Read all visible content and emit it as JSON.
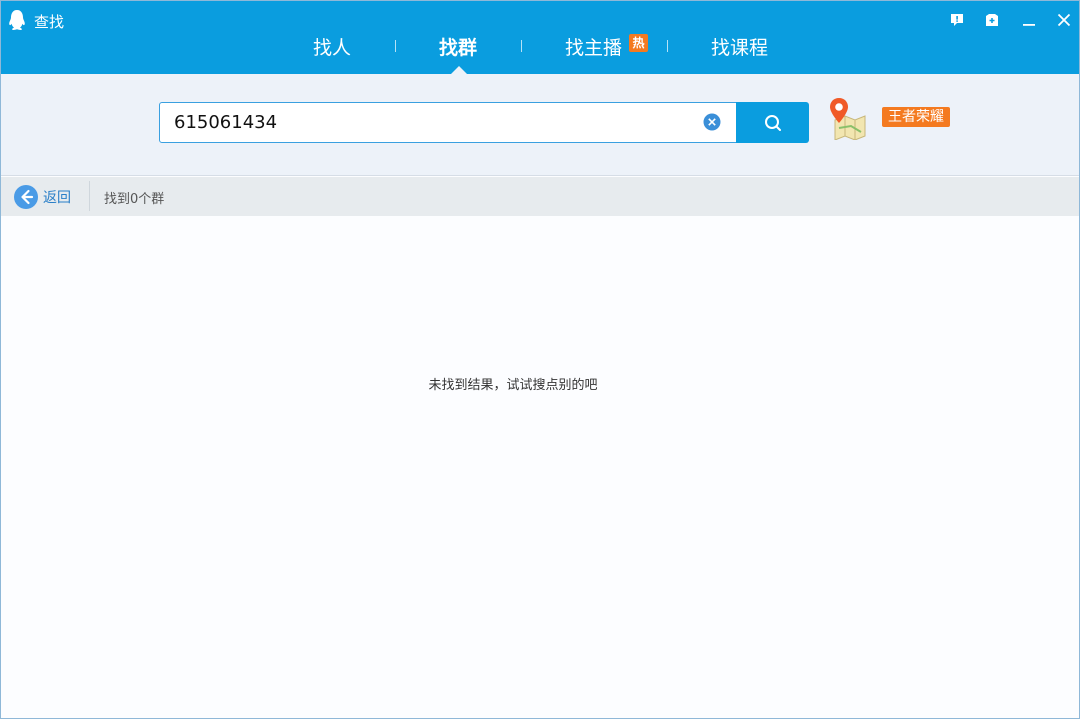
{
  "window": {
    "title": "查找",
    "buttons": [
      "feedback-icon",
      "skin-icon",
      "minimize-icon",
      "close-icon"
    ]
  },
  "tabs": [
    {
      "label": "找人",
      "active": false
    },
    {
      "label": "找群",
      "active": true
    },
    {
      "label": "找主播",
      "active": false,
      "badge": "热"
    },
    {
      "label": "找课程",
      "active": false
    }
  ],
  "search": {
    "value": "615061434",
    "location_tag": "王者荣耀"
  },
  "result_bar": {
    "back_label": "返回",
    "count_text": "找到0个群"
  },
  "content": {
    "empty_message": "未找到结果，试试搜点别的吧"
  },
  "colors": {
    "primary": "#0a9ddf",
    "badge": "#f47a20",
    "link": "#2a7fc8"
  }
}
